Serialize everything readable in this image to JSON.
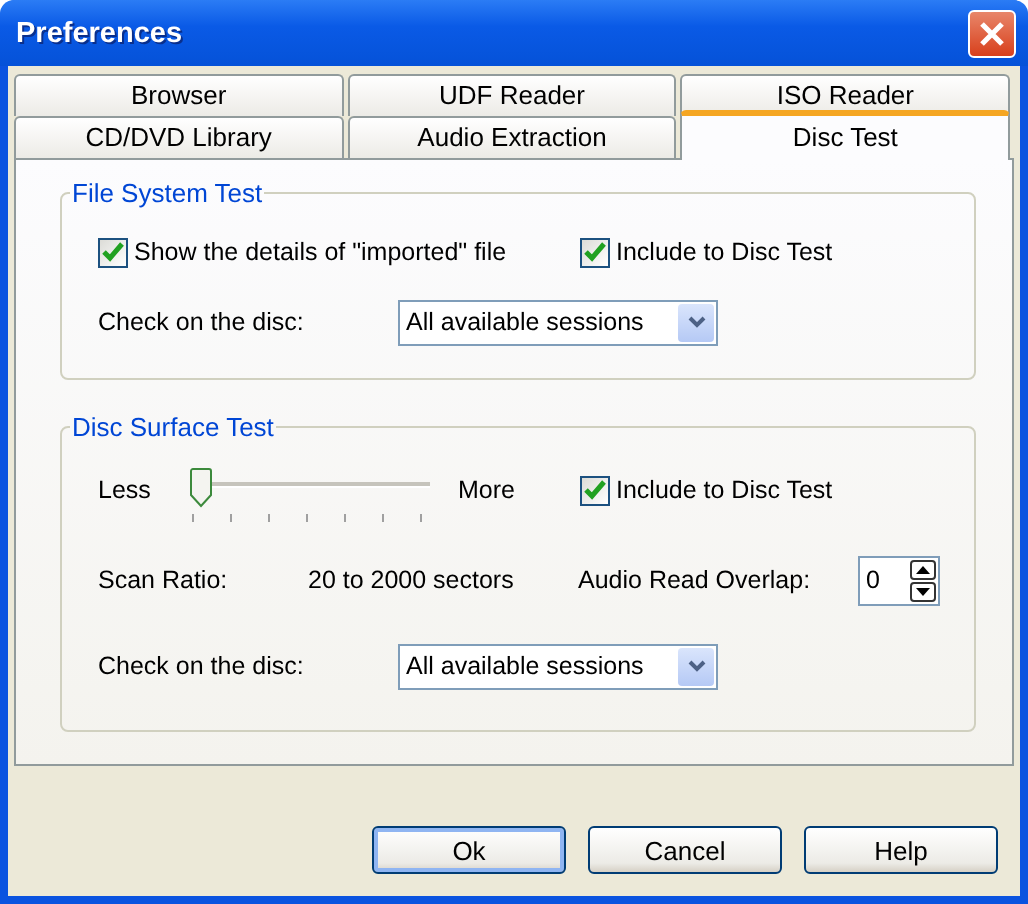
{
  "window": {
    "title": "Preferences"
  },
  "tab_rows": [
    [
      {
        "label": "Browser",
        "selected": false
      },
      {
        "label": "UDF Reader",
        "selected": false
      },
      {
        "label": "ISO Reader",
        "selected": false
      }
    ],
    [
      {
        "label": "CD/DVD Library",
        "selected": false
      },
      {
        "label": "Audio Extraction",
        "selected": false
      },
      {
        "label": "Disc Test",
        "selected": true
      }
    ]
  ],
  "file_system_test": {
    "title": "File System Test",
    "options": [
      {
        "label": "Show the details of \"imported\" file",
        "checked": true
      },
      {
        "label": "Include to Disc Test",
        "checked": true
      }
    ],
    "check_label": "Check on the disc:",
    "check_value": "All available sessions"
  },
  "disc_surface_test": {
    "title": "Disc Surface Test",
    "slider": {
      "min_label": "Less",
      "max_label": "More",
      "level": 0
    },
    "include": {
      "label": "Include to Disc Test",
      "checked": true
    },
    "scan_label": "Scan Ratio:",
    "scan_value": "20 to 2000 sectors",
    "overlap_label": "Audio Read Overlap:",
    "overlap_value": "0",
    "check_label": "Check on the disc:",
    "check_value": "All available sessions"
  },
  "buttons": [
    {
      "label": "Ok",
      "default": true
    },
    {
      "label": "Cancel",
      "default": false
    },
    {
      "label": "Help",
      "default": false
    }
  ]
}
